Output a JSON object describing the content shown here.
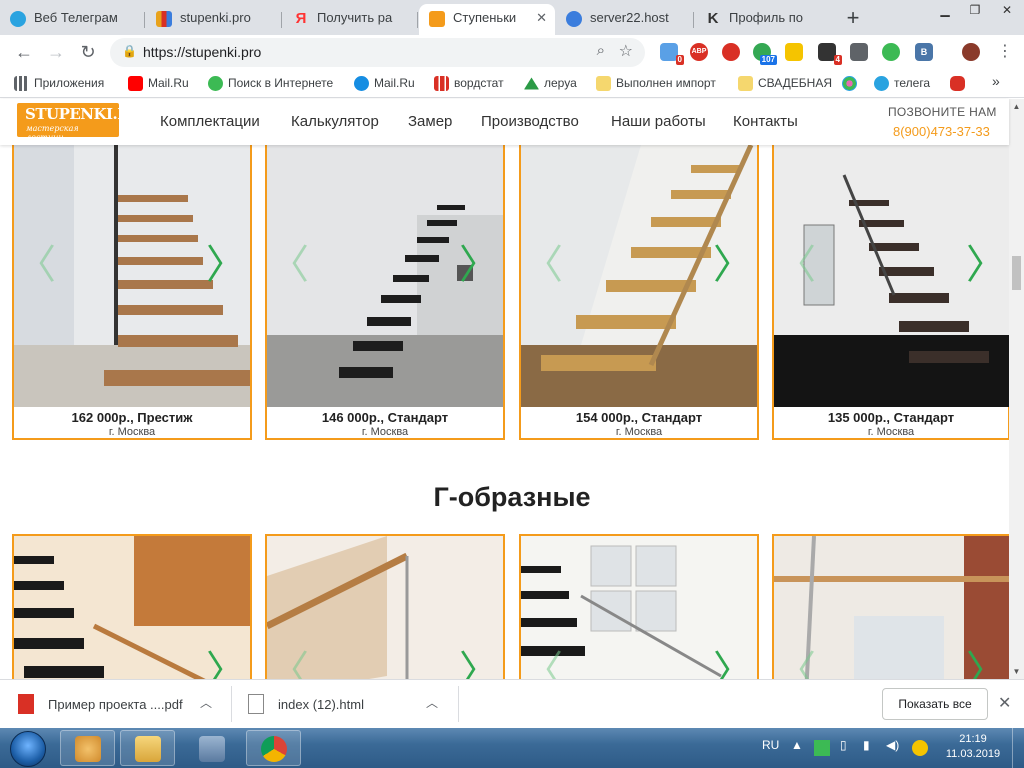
{
  "browser": {
    "tabs": [
      {
        "label": "Веб Телеграм",
        "icon": "telegram-icon",
        "color": "#2aa3e0"
      },
      {
        "label": "stupenki.pro",
        "icon": "analytics-icon",
        "color": "#e8a21c"
      },
      {
        "label": "Получить ра",
        "icon": "yandex-icon",
        "color": "#ff3333"
      },
      {
        "label": "Ступеньки",
        "icon": "stupenki-icon",
        "color": "#f49b1b"
      },
      {
        "label": "server22.host",
        "icon": "globe-icon",
        "color": "#3b7ddd"
      },
      {
        "label": "Профиль по",
        "icon": "k-icon",
        "color": "#333333"
      }
    ],
    "tab_close": "✕",
    "new_tab": "+",
    "url": "https://stupenki.pro",
    "extensions": [
      {
        "name": "cloud-ext-icon",
        "badge": "0",
        "color": "#5aa0e6"
      },
      {
        "name": "adblock-icon",
        "text": "ABP",
        "color": "#d93025"
      },
      {
        "name": "stop-icon",
        "color": "#d93025"
      },
      {
        "name": "counter-ext-icon",
        "badge": "107",
        "color": "#34a853"
      },
      {
        "name": "yandex-ext-icon",
        "color": "#f5c400"
      },
      {
        "name": "mail-ext-icon",
        "badge": "4",
        "color": "#333333"
      },
      {
        "name": "camera-icon",
        "color": "#5f6368"
      },
      {
        "name": "green-ext-icon",
        "color": "#3cba54"
      },
      {
        "name": "vk-icon",
        "text": "B",
        "color": "#4a76a8"
      },
      {
        "name": "mail-tray-icon",
        "color": "#5f6368"
      },
      {
        "name": "pen-icon",
        "color": "#8a3a2a"
      }
    ]
  },
  "bookmarks": [
    {
      "label": "Приложения",
      "icon": "apps-icon",
      "color": "#5f6368"
    },
    {
      "label": "Mail.Ru",
      "icon": "youtube-icon",
      "color": "#ff0000"
    },
    {
      "label": "Поиск в Интернете",
      "icon": "ke-icon",
      "color": "#3cba54"
    },
    {
      "label": "Mail.Ru",
      "icon": "mailru-icon",
      "color": "#168de2"
    },
    {
      "label": "вордстат",
      "icon": "bars-icon",
      "color": "#d93025"
    },
    {
      "label": "леруа",
      "icon": "leroy-icon",
      "color": "#2b9a46"
    },
    {
      "label": "Выполнен импорт",
      "icon": "folder-icon",
      "color": "#f5d76e"
    },
    {
      "label": "СВАДЕБНАЯ",
      "icon": "folder-icon",
      "color": "#f5d76e"
    },
    {
      "label": "",
      "icon": "colorful-icon",
      "color": "#e56bb3"
    },
    {
      "label": "телега",
      "icon": "telegram-icon",
      "color": "#2aa3e0"
    },
    {
      "label": "",
      "icon": "rambler-icon",
      "color": "#d93025"
    }
  ],
  "site": {
    "logo_title": "STUPENKI.PRO",
    "logo_subtitle": "мастерская лестниц",
    "nav": [
      "Комплектации",
      "Калькулятор",
      "Замер",
      "Производство",
      "Наши работы",
      "Контакты"
    ],
    "call_us": "ПОЗВОНИТЕ НАМ",
    "phone": "8(900)473-37-33",
    "brand_color": "#f49b1b"
  },
  "products_row1": [
    {
      "price": "162 000р., Престиж",
      "city": "г. Москва"
    },
    {
      "price": "146 000р., Стандарт",
      "city": "г. Москва"
    },
    {
      "price": "154 000р., Стандарт",
      "city": "г. Москва"
    },
    {
      "price": "135 000р., Стандарт",
      "city": "г. Москва"
    }
  ],
  "section_title": "Г-образные",
  "downloads": [
    {
      "name": "Пример проекта ....pdf",
      "icon": "pdf-icon"
    },
    {
      "name": "index (12).html",
      "icon": "file-icon"
    }
  ],
  "show_all": "Показать все",
  "taskbar": {
    "lang": "RU",
    "time": "21:19",
    "date": "11.03.2019"
  }
}
